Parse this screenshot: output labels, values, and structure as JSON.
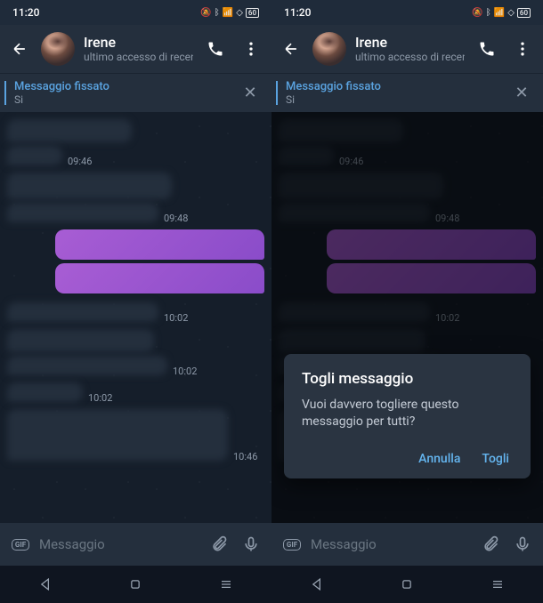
{
  "status": {
    "time": "11:20",
    "battery": "60"
  },
  "header": {
    "name": "Irene",
    "subtitle": "ultimo accesso di recente"
  },
  "pinned": {
    "title": "Messaggio fissato",
    "subtitle": "Si"
  },
  "messages": {
    "ts1": "09:46",
    "ts2": "09:48",
    "ts3": "10:02",
    "ts4": "10:02",
    "ts5": "10:02",
    "ts6": "10:46"
  },
  "input": {
    "placeholder": "Messaggio"
  },
  "dialog": {
    "title": "Togli messaggio",
    "body": "Vuoi davvero togliere questo messaggio per tutti?",
    "cancel": "Annulla",
    "confirm": "Togli"
  }
}
